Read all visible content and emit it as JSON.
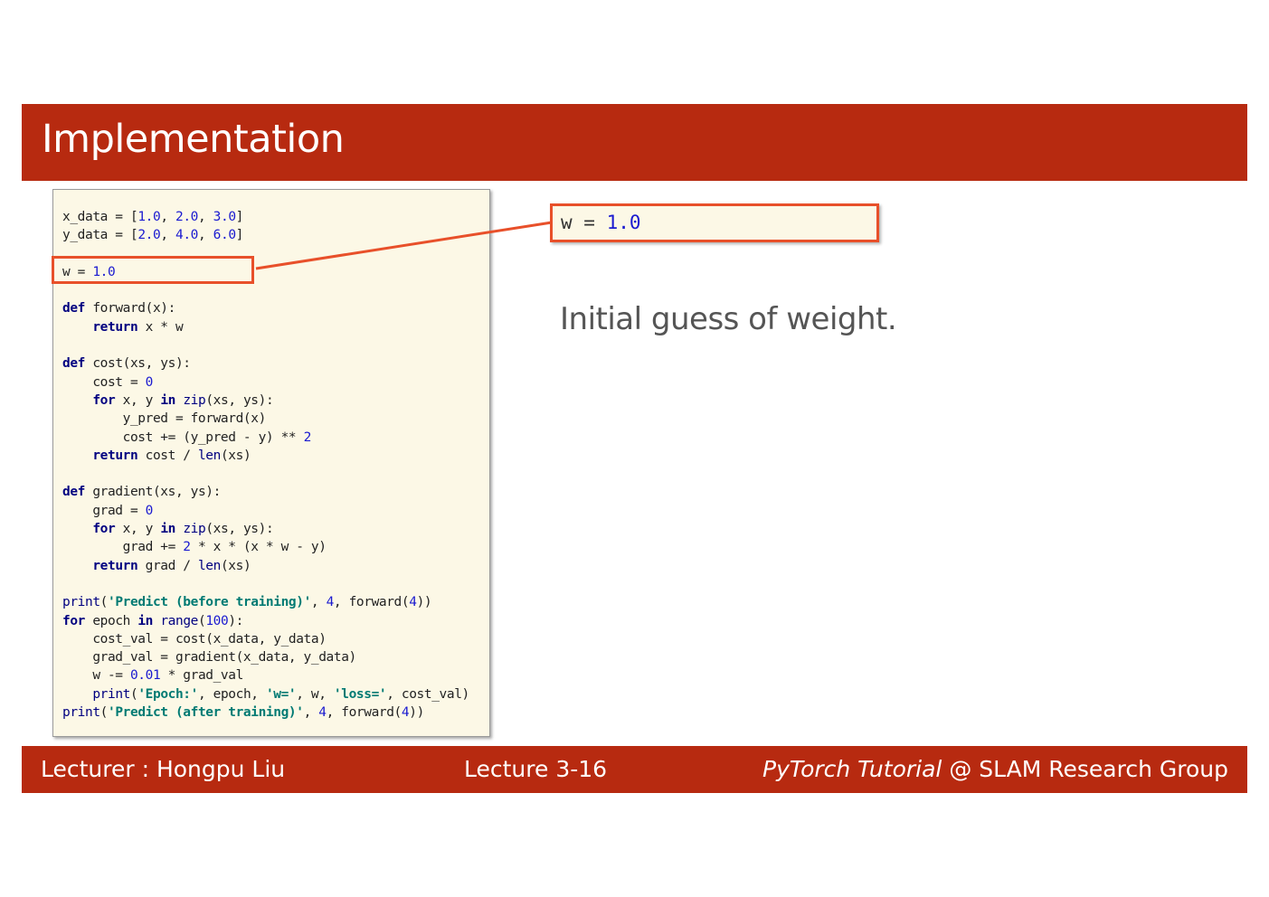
{
  "title": "Implementation",
  "code_lines": [
    "x_data = [1.0, 2.0, 3.0]",
    "y_data = [2.0, 4.0, 6.0]",
    "",
    "w = 1.0",
    "",
    "def forward(x):",
    "    return x * w",
    "",
    "def cost(xs, ys):",
    "    cost = 0",
    "    for x, y in zip(xs, ys):",
    "        y_pred = forward(x)",
    "        cost += (y_pred - y) ** 2",
    "    return cost / len(xs)",
    "",
    "def gradient(xs, ys):",
    "    grad = 0",
    "    for x, y in zip(xs, ys):",
    "        grad += 2 * x * (x * w - y)",
    "    return grad / len(xs)",
    "",
    "print('Predict (before training)', 4, forward(4))",
    "for epoch in range(100):",
    "    cost_val = cost(x_data, y_data)",
    "    grad_val = gradient(x_data, y_data)",
    "    w -= 0.01 * grad_val",
    "    print('Epoch:', epoch, 'w=', w, 'loss=', cost_val)",
    "print('Predict (after training)', 4, forward(4))"
  ],
  "callout": {
    "lhs": "w = ",
    "value": "1.0"
  },
  "description": "Initial guess of weight.",
  "footer": {
    "lecturer": "Lecturer : Hongpu Liu",
    "lecture": "Lecture 3-16",
    "course_italic": "PyTorch Tutorial",
    "group": " @ SLAM Research Group"
  },
  "colors": {
    "brand": "#b72a10",
    "highlight": "#e8502a",
    "code_background": "#fcf8e6"
  }
}
